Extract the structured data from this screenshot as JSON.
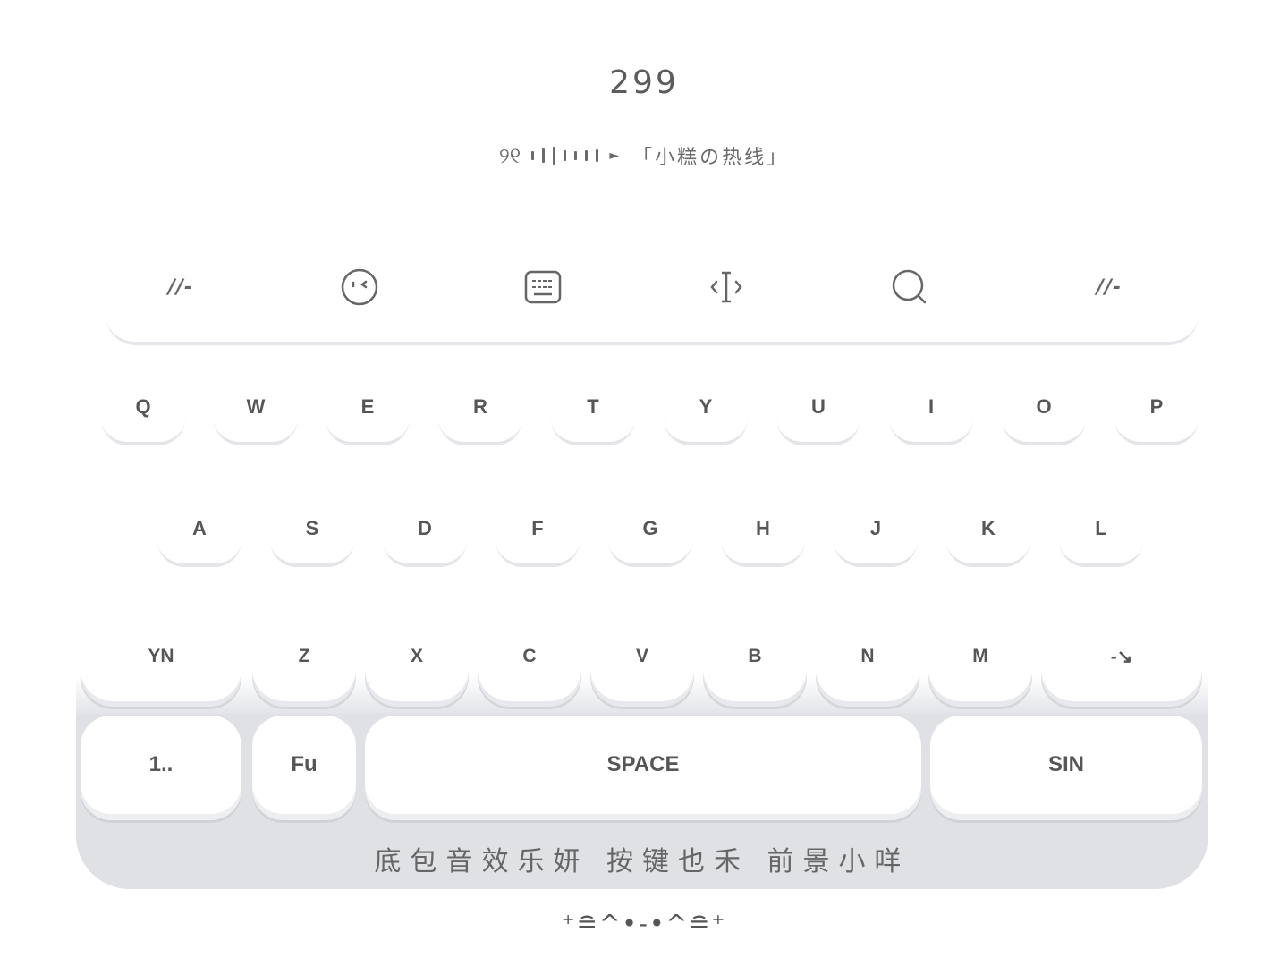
{
  "header": {
    "count": "299",
    "credit_logo": "୨୧",
    "credit_title": "「小糕の热线」"
  },
  "toolbar": {
    "left_label": "//-",
    "right_label": "//-",
    "items": [
      {
        "name": "emoji",
        "icon": "emoji-face-icon"
      },
      {
        "name": "keyboard",
        "icon": "keyboard-icon"
      },
      {
        "name": "cursor",
        "icon": "cursor-move-icon"
      },
      {
        "name": "search",
        "icon": "search-icon"
      }
    ]
  },
  "keyboard": {
    "row1": [
      "Q",
      "W",
      "E",
      "R",
      "T",
      "Y",
      "U",
      "I",
      "O",
      "P"
    ],
    "row2": [
      "A",
      "S",
      "D",
      "F",
      "G",
      "H",
      "J",
      "K",
      "L"
    ],
    "row3_left": "YN",
    "row3": [
      "Z",
      "X",
      "C",
      "V",
      "B",
      "N",
      "M"
    ],
    "row3_right": "-↘",
    "bottom": {
      "numbers": "1..",
      "function": "Fu",
      "space": "SPACE",
      "send": "SIN"
    },
    "slogan": "底包音效乐妍 按键也禾 前景小咩"
  },
  "footer": {
    "kaomoji": "⁺≘^•-•^≘⁺"
  },
  "colors": {
    "background": "#ffffff",
    "keyboard_base": "#dfe1e5",
    "key_face": "#ffffff",
    "text": "#5d5d5d"
  }
}
